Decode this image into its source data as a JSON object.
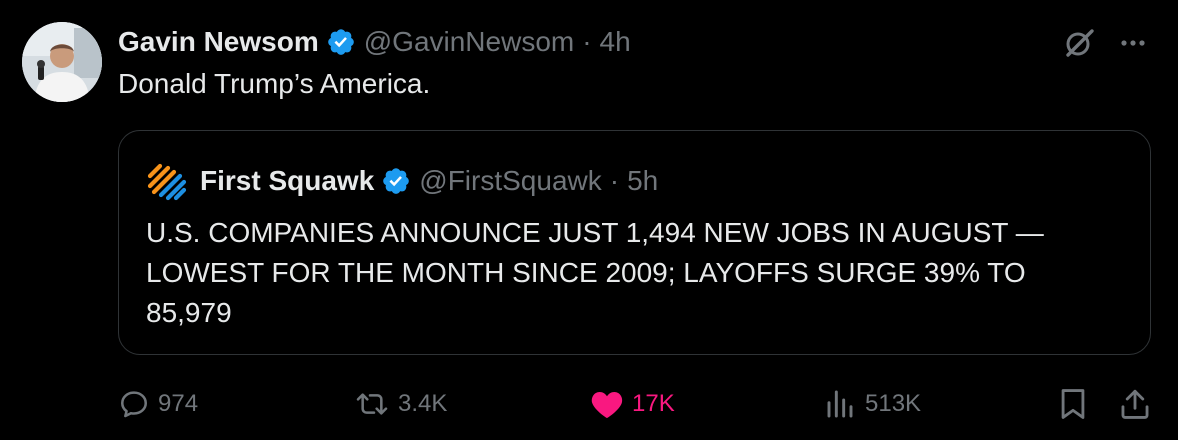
{
  "tweet": {
    "author": {
      "name": "Gavin Newsom",
      "handle": "@GavinNewsom",
      "time": "4h",
      "separator": "·"
    },
    "text": "Donald Trump’s America.",
    "quoted": {
      "name": "First Squawk",
      "handle": "@FirstSquawk",
      "time": "5h",
      "separator": "·",
      "text": "U.S. COMPANIES ANNOUNCE JUST 1,494 NEW JOBS IN AUGUST — LOWEST FOR THE MONTH SINCE 2009; LAYOFFS SURGE 39% TO 85,979"
    },
    "actions": {
      "replies": "974",
      "reposts": "3.4K",
      "likes": "17K",
      "views": "513K"
    }
  },
  "icons": {
    "top_right": [
      "grok-icon",
      "more-icon"
    ],
    "actions": [
      "reply-icon",
      "repost-icon",
      "like-icon",
      "views-icon",
      "bookmark-icon",
      "share-icon"
    ]
  },
  "colors": {
    "background": "#000000",
    "text": "#e7e9ea",
    "muted": "#71767b",
    "verified": "#1d9bf0",
    "like": "#f91880",
    "border": "#2f3336",
    "logo_orange": "#f7931a",
    "logo_blue": "#1d8fe1"
  }
}
